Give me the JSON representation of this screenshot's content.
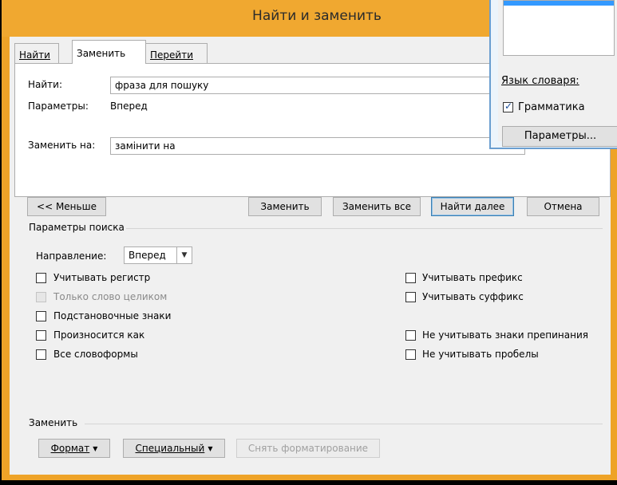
{
  "title": "Найти и заменить",
  "tabs": [
    "Найти",
    "Заменить",
    "Перейти"
  ],
  "find": {
    "label": "Найти:",
    "value": "фраза для пошуку"
  },
  "options": {
    "label": "Параметры:",
    "value": "Вперед"
  },
  "replace": {
    "label": "Заменить на:",
    "value": "замінити на"
  },
  "buttons": {
    "less": "<< Меньше",
    "replace": "Заменить",
    "replace_all": "Заменить все",
    "find_next": "Найти далее",
    "cancel": "Отмена"
  },
  "search_options": {
    "header": "Параметры поиска",
    "direction_label": "Направление:",
    "direction_value": "Вперед",
    "left": [
      {
        "label": "Учитывать регистр",
        "checked": false,
        "disabled": false
      },
      {
        "label": "Только слово целиком",
        "checked": false,
        "disabled": true
      },
      {
        "label": "Подстановочные знаки",
        "checked": false,
        "disabled": false
      },
      {
        "label": "Произносится как",
        "checked": false,
        "disabled": false
      },
      {
        "label": "Все словоформы",
        "checked": false,
        "disabled": false
      }
    ],
    "right": [
      {
        "label": "Учитывать префикс",
        "checked": false
      },
      {
        "label": "Учитывать суффикс",
        "checked": false
      },
      {
        "label": "Не учитывать знаки препинания",
        "checked": false
      },
      {
        "label": "Не учитывать пробелы",
        "checked": false
      }
    ]
  },
  "replace_section": {
    "header": "Заменить",
    "format": "Формат",
    "special": "Специальный",
    "clear": "Снять форматирование"
  },
  "background_window": {
    "dict_lang": "Язык словаря:",
    "grammar": "Грамматика",
    "params": "Параметры..."
  },
  "colors": {
    "titlebar": "#f0a830",
    "accent": "#3c7fb1",
    "bg_window_border": "#6a9ed0"
  }
}
